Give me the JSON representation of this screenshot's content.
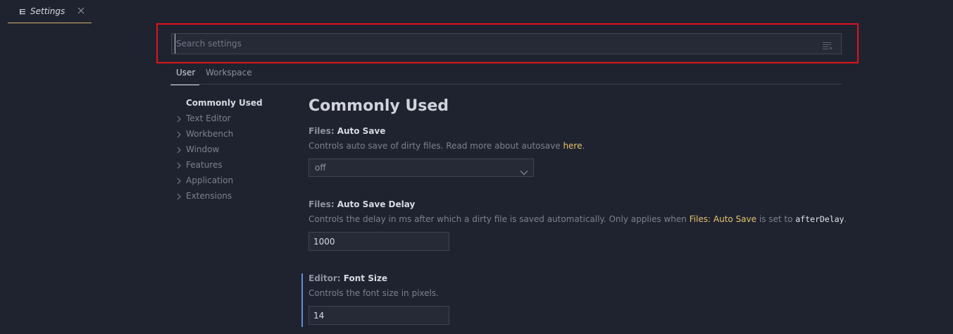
{
  "tab": {
    "label": "Settings",
    "icon": "settings-list-icon",
    "close_icon": "close-icon"
  },
  "search": {
    "placeholder": "Search settings",
    "value": "",
    "clear_filter_icon": "clear-filter-icon"
  },
  "scopes": {
    "user": "User",
    "workspace": "Workspace",
    "active": "User"
  },
  "toc": {
    "items": [
      {
        "label": "Commonly Used",
        "active": true,
        "expandable": false
      },
      {
        "label": "Text Editor",
        "active": false,
        "expandable": true
      },
      {
        "label": "Workbench",
        "active": false,
        "expandable": true
      },
      {
        "label": "Window",
        "active": false,
        "expandable": true
      },
      {
        "label": "Features",
        "active": false,
        "expandable": true
      },
      {
        "label": "Application",
        "active": false,
        "expandable": true
      },
      {
        "label": "Extensions",
        "active": false,
        "expandable": true
      }
    ]
  },
  "content": {
    "title": "Commonly Used",
    "settings": [
      {
        "category": "Files: ",
        "name": "Auto Save",
        "desc_before": "Controls auto save of dirty files. Read more about autosave ",
        "desc_link": "here",
        "desc_after": ".",
        "control": "select",
        "value": "off"
      },
      {
        "category": "Files: ",
        "name": "Auto Save Delay",
        "desc_before": "Controls the delay in ms after which a dirty file is saved automatically. Only applies when ",
        "desc_link": "Files: Auto Save",
        "desc_middle": " is set to ",
        "desc_code": "afterDelay",
        "desc_after": ".",
        "control": "number",
        "value": "1000"
      },
      {
        "category": "Editor: ",
        "name": "Font Size",
        "desc_before": "Controls the font size in pixels.",
        "control": "number",
        "value": "14",
        "modified": true
      }
    ]
  },
  "colors": {
    "background": "#1f2330",
    "accent_link": "#e7c36b",
    "highlight_border": "#e0121a",
    "modified_indicator": "#5b8fd6",
    "active_tab_underline": "#d9b46b"
  }
}
